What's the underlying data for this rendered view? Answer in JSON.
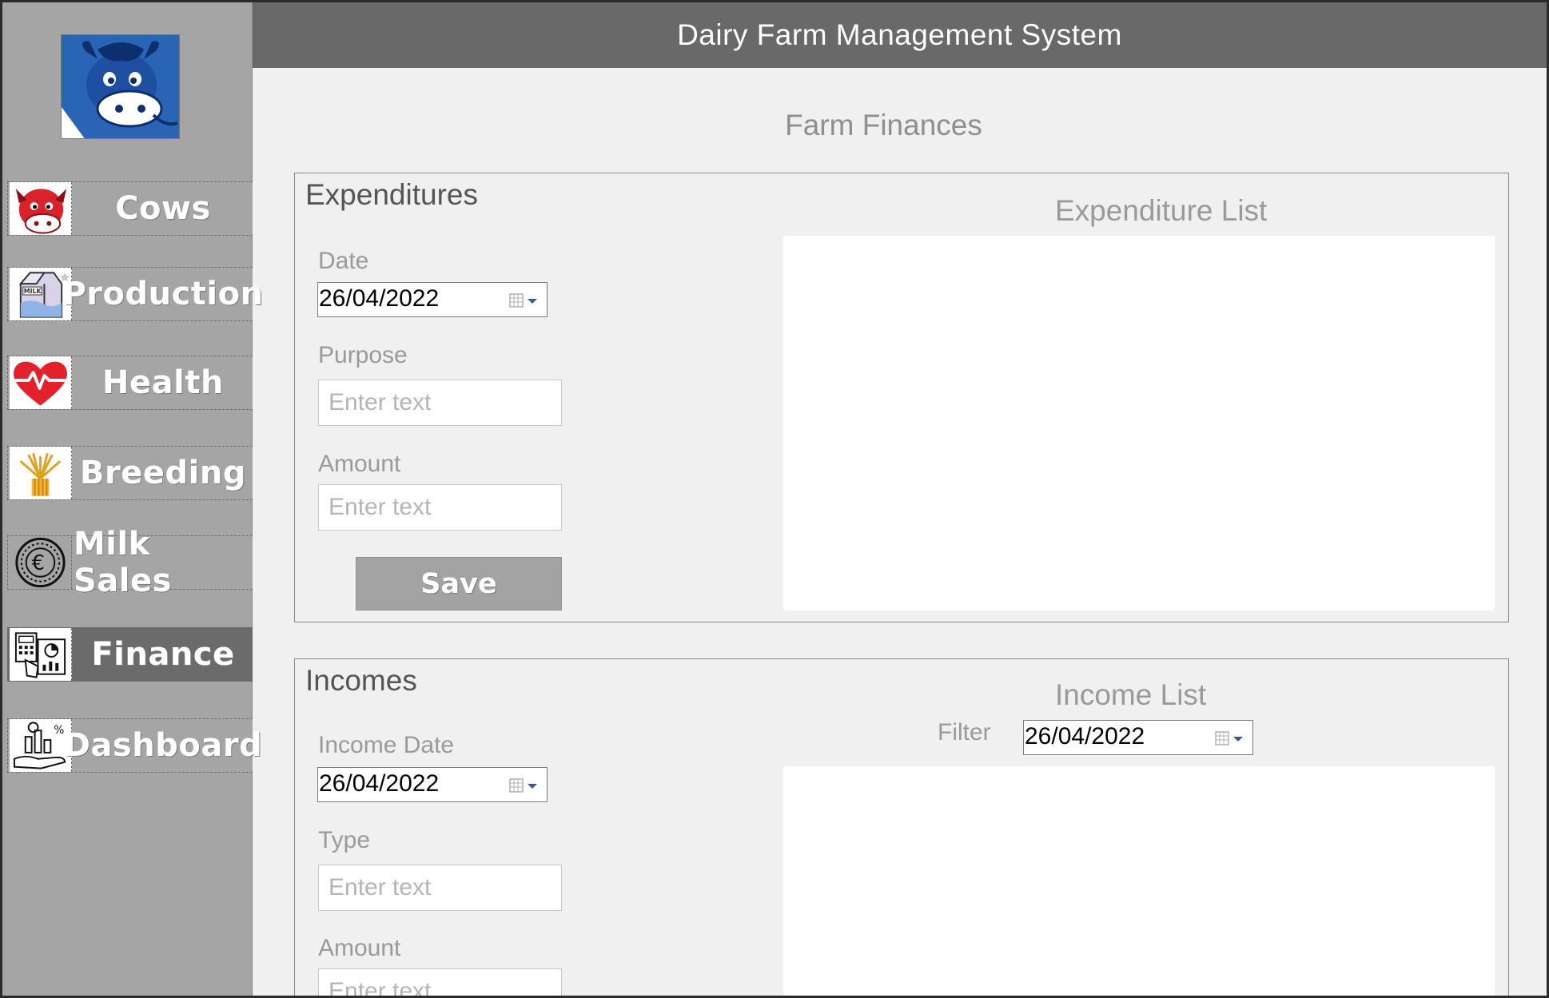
{
  "app": {
    "title": "Dairy Farm Management System"
  },
  "sidebar": {
    "logo_icon": "blue-cow-logo-icon",
    "items": [
      {
        "label": "Cows",
        "icon": "cow-icon",
        "active": false
      },
      {
        "label": "Production",
        "icon": "milk-carton-icon",
        "active": false
      },
      {
        "label": "Health",
        "icon": "heart-pulse-icon",
        "active": false
      },
      {
        "label": "Breeding",
        "icon": "wheat-icon",
        "active": false
      },
      {
        "label": "Milk Sales",
        "icon": "euro-coin-icon",
        "active": false
      },
      {
        "label": "Finance",
        "icon": "calculator-chart-icon",
        "active": true
      },
      {
        "label": "Dashboard",
        "icon": "dashboard-chart-icon",
        "active": false
      }
    ]
  },
  "page": {
    "title": "Farm Finances"
  },
  "expenditures": {
    "title": "Expenditures",
    "date_label": "Date",
    "date_value": "26/04/2022",
    "purpose_label": "Purpose",
    "purpose_placeholder": "Enter text",
    "amount_label": "Amount",
    "amount_placeholder": "Enter text",
    "save_label": "Save",
    "list_title": "Expenditure List"
  },
  "incomes": {
    "title": "Incomes",
    "date_label": "Income Date",
    "date_value": "26/04/2022",
    "type_label": "Type",
    "type_placeholder": "Enter text",
    "amount_label": "Amount",
    "amount_placeholder": "Enter text",
    "list_title": "Income List",
    "filter_label": "Filter",
    "filter_value": "26/04/2022"
  },
  "colors": {
    "sidebar": "#a5a5a5",
    "header": "#696969",
    "active_nav": "#6b6b6b",
    "content_bg": "#f0f0f0",
    "button": "#a3a3a3"
  }
}
